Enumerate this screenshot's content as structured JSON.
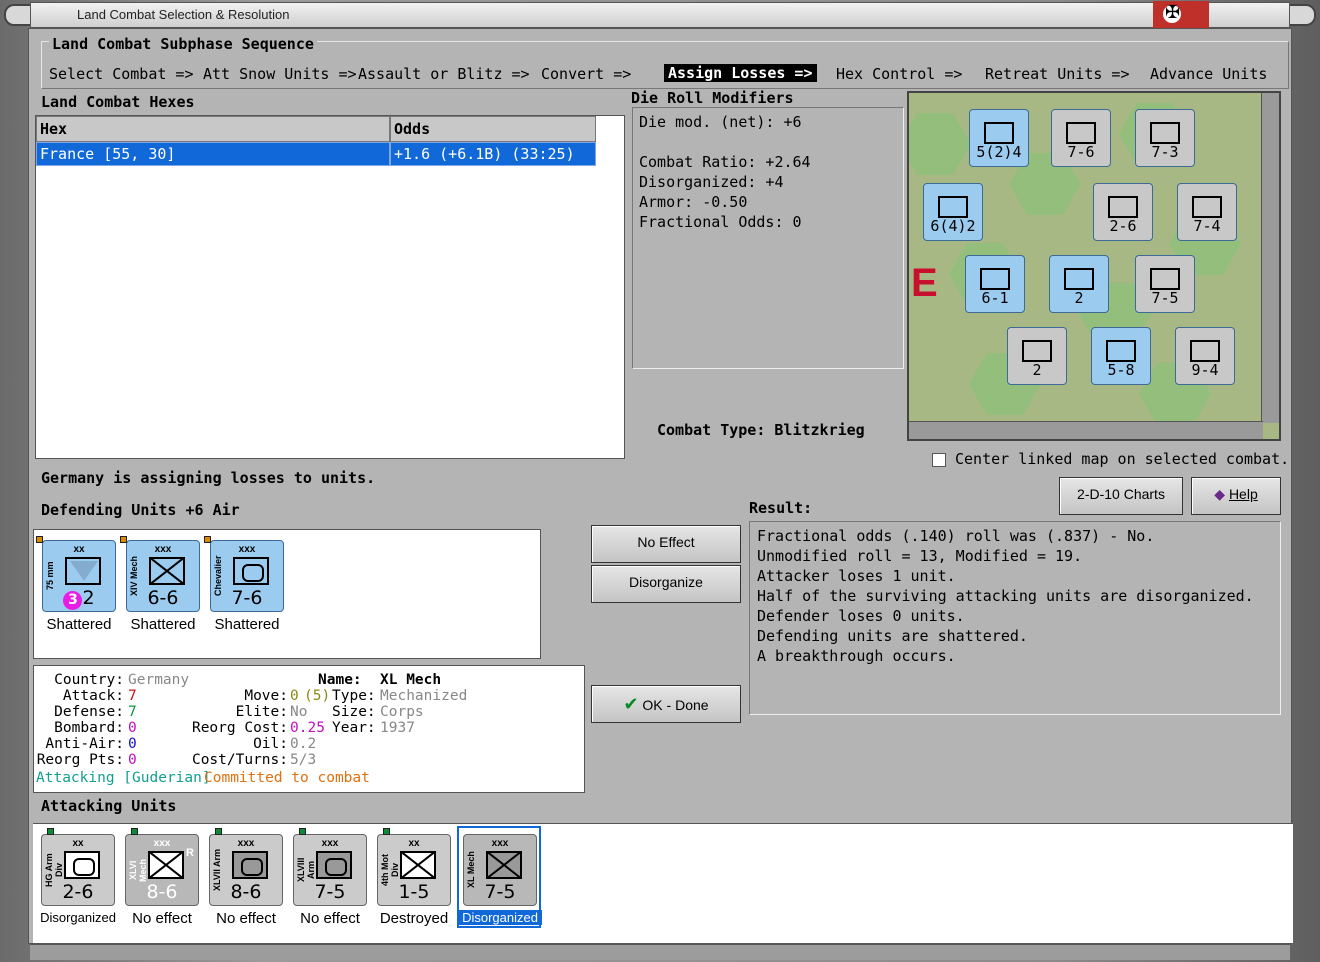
{
  "window": {
    "title": "Land Combat Selection & Resolution"
  },
  "sequence": {
    "title": "Land Combat Subphase Sequence",
    "steps": [
      "Select Combat =>",
      "Att Snow Units =>",
      "Assault or Blitz =>",
      "Convert =>",
      "Assign Losses =>",
      "Hex Control =>",
      "Retreat Units =>",
      "Advance Units"
    ],
    "active_index": 4
  },
  "combat_hexes": {
    "title": "Land Combat Hexes",
    "columns": [
      "Hex",
      "Odds"
    ],
    "rows": [
      {
        "hex": "France [55, 30]",
        "odds": "+1.6 (+6.1B) (33:25)"
      }
    ]
  },
  "die_roll_modifiers": {
    "title": "Die Roll Modifiers",
    "lines": [
      "Die mod. (net): +6",
      "",
      "Combat Ratio: +2.64",
      "Disorganized: +4",
      "Armor: -0.50",
      "Fractional Odds: 0"
    ]
  },
  "map": {
    "counters": [
      {
        "label": "5(2)4"
      },
      {
        "label": "7-6"
      },
      {
        "label": "7-3"
      },
      {
        "label": "6(4)2"
      },
      {
        "label": "2-6"
      },
      {
        "label": "7-4"
      },
      {
        "label": "6-1"
      },
      {
        "label": "2"
      },
      {
        "label": "7-5"
      },
      {
        "label": "2"
      },
      {
        "label": "5-8"
      },
      {
        "label": "9-4"
      }
    ],
    "map_letter": "E"
  },
  "combat_type": {
    "label": "Combat Type:",
    "value": "Blitzkrieg"
  },
  "center_map": {
    "label": "Center linked map on selected combat.",
    "checked": false
  },
  "status": "Germany is assigning losses to units.",
  "defending": {
    "title": "Defending Units +6 Air",
    "units": [
      {
        "size": "xx",
        "name": "75 mm",
        "circle": "3",
        "value": "2",
        "symbol": "v",
        "result": "Shattered"
      },
      {
        "size": "xxx",
        "name": "XIV Mech",
        "value": "6-6",
        "symbol": "x",
        "result": "Shattered"
      },
      {
        "size": "xxx",
        "name": "Chevalier",
        "value": "7-6",
        "symbol": "o",
        "result": "Shattered"
      }
    ]
  },
  "unit_info": {
    "country_label": "Country:",
    "country": "Germany",
    "name_label": "Name:",
    "name": "XL Mech",
    "attack_label": "Attack:",
    "attack": "7",
    "move_label": "Move:",
    "move": "0",
    "move_paren": "(5)",
    "type_label": "Type:",
    "type": "Mechanized",
    "defense_label": "Defense:",
    "defense": "7",
    "elite_label": "Elite:",
    "elite": "No",
    "size_label": "Size:",
    "size": "Corps",
    "bombard_label": "Bombard:",
    "bombard": "0",
    "reorg_label": "Reorg Cost:",
    "reorg": "0.25",
    "year_label": "Year:",
    "year": "1937",
    "antiair_label": "Anti-Air:",
    "antiair": "0",
    "oil_label": "Oil:",
    "oil": "0.2",
    "reorgpts_label": "Reorg Pts:",
    "reorgpts": "0",
    "costturns_label": "Cost/Turns:",
    "costturns": "5/3",
    "attacking": "Attacking [Guderian]",
    "committed": "Committed to combat"
  },
  "buttons": {
    "no_effect": "No Effect",
    "disorganize": "Disorganize",
    "ok": "OK - Done",
    "charts": "2-D-10 Charts",
    "help": "Help"
  },
  "result": {
    "title": "Result:",
    "lines": [
      "Fractional odds (.140) roll was (.837)  - No.",
      "Unmodified roll = 13, Modified = 19.",
      "Attacker loses 1 unit.",
      "Half of the surviving attacking units are disorganized.",
      "Defender loses 0 units.",
      "Defending units are shattered.",
      "A breakthrough occurs."
    ]
  },
  "attacking": {
    "title": "Attacking Units",
    "units": [
      {
        "size": "xx",
        "name": "HG Arm Div",
        "value": "2-6",
        "symbol": "o",
        "grey": true,
        "result": "Disorganized"
      },
      {
        "size": "xxx",
        "name": "XLVI Mech",
        "value": "8-6",
        "symbol": "x",
        "grey": true,
        "r": "R",
        "result": "No effect"
      },
      {
        "size": "xxx",
        "name": "XLVII Arm",
        "value": "8-6",
        "symbol": "o",
        "grey": true,
        "result": "No effect"
      },
      {
        "size": "xxx",
        "name": "XLVIII Arm",
        "value": "7-5",
        "symbol": "o",
        "grey": true,
        "result": "No effect"
      },
      {
        "size": "xx",
        "name": "4th Mot Div",
        "value": "1-5",
        "symbol": "x",
        "grey": true,
        "result": "Destroyed"
      },
      {
        "size": "xxx",
        "name": "XL Mech",
        "value": "7-5",
        "symbol": "x",
        "grey": false,
        "result": "Disorganized"
      }
    ]
  }
}
